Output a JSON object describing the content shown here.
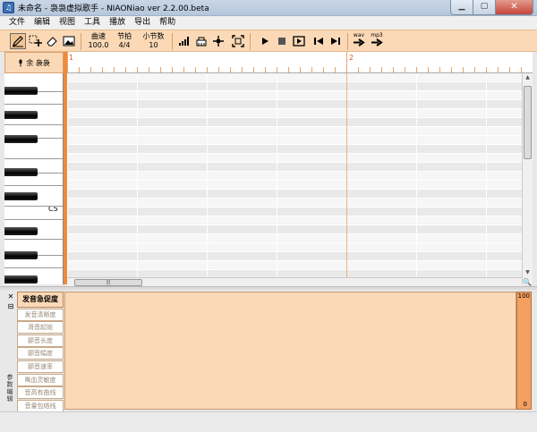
{
  "window": {
    "title": "未命名 - 袅袅虚拟歌手 - NIAONiao ver 2.2.00.beta",
    "icon": "app-icon"
  },
  "menu": [
    "文件",
    "编辑",
    "视图",
    "工具",
    "播放",
    "导出",
    "帮助"
  ],
  "toolbar": {
    "tempo_label": "曲速",
    "tempo_value": "100.0",
    "beat_label": "节拍",
    "beat_value": "4/4",
    "bar_label": "小节数",
    "bar_value": "10",
    "export_wav": "wav",
    "export_mp3": "mp3"
  },
  "track": {
    "header_label": "余 袅袅",
    "mic_icon": "microphone-icon"
  },
  "ruler": {
    "measures": [
      "1",
      "2"
    ]
  },
  "piano": {
    "c5_label": "C5"
  },
  "scroll": {
    "grip": "|||"
  },
  "params": {
    "items": [
      "发音急促度",
      "发音清晰度",
      "滑音起始",
      "颤音长度",
      "颤音幅度",
      "颤音速率",
      "嘶血灵敏度",
      "音高有曲线",
      "音量包络线"
    ],
    "active_index": 0,
    "vertical_label": "参数编辑",
    "scale_max": "100",
    "scale_min": "0"
  },
  "colors": {
    "accent": "#fbd9b6",
    "orange": "#f08a3a"
  }
}
